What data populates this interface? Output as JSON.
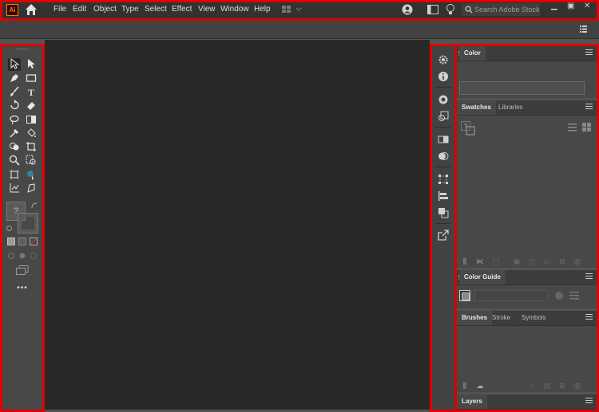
{
  "app": {
    "logo": "Ai"
  },
  "menu": {
    "items": [
      "File",
      "Edit",
      "Object",
      "Type",
      "Select",
      "Effect",
      "View",
      "Window",
      "Help"
    ]
  },
  "search": {
    "placeholder": "Search Adobe Stock"
  },
  "panels": {
    "color": {
      "title": "Color"
    },
    "swatches": {
      "tabs": [
        "Swatches",
        "Libraries"
      ]
    },
    "color_guide": {
      "title": "Color Guide"
    },
    "brushes": {
      "tabs": [
        "Brushes",
        "Stroke",
        "Symbols"
      ]
    },
    "layers": {
      "title": "Layers"
    }
  },
  "toolbar": {
    "unknown_glyph": "?",
    "more_tools": "•••"
  },
  "colors": {
    "accent_highlight": "#e00000",
    "menubar": "#323232",
    "canvas": "#282828",
    "panel": "#484848"
  }
}
